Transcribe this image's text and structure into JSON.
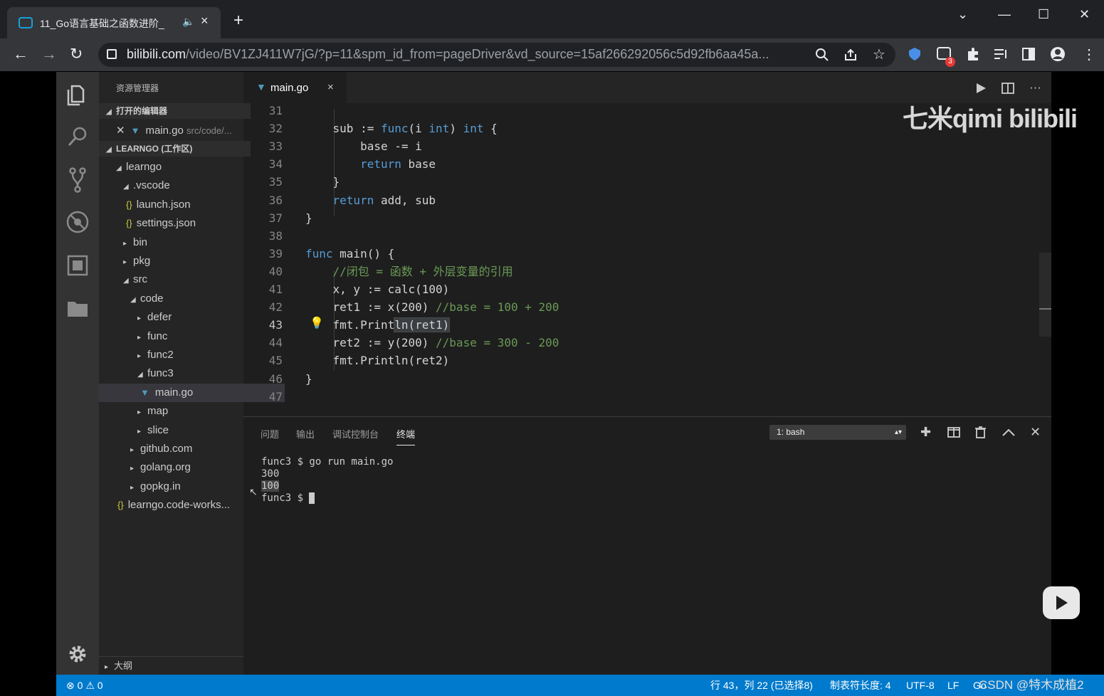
{
  "browser": {
    "tab_title": "11_Go语言基础之函数进阶_",
    "tab_speaker": "🔈",
    "tab_close": "×",
    "new_tab": "+",
    "window_controls": {
      "dropdown": "⌄",
      "minimize": "—",
      "maximize": "☐",
      "close": "✕"
    },
    "nav": {
      "back": "←",
      "forward": "→",
      "reload": "↻"
    },
    "url_host": "bilibili.com",
    "url_rest": "/video/BV1ZJ411W7jG/?p=11&spm_id_from=pageDriver&vd_source=15af266292056c5d92fb6aa45a...",
    "extension_badge": "3",
    "accent_color": "#18a0d8"
  },
  "vscode": {
    "sidebar": {
      "header": "资源管理器",
      "open_editors_label": "打开的编辑器",
      "open_editor_file": "main.go",
      "open_editor_path": "src/code/...",
      "workspace_label": "LEARNGO (工作区)",
      "tree": [
        {
          "label": "learngo",
          "arrow": "◢"
        },
        {
          "label": ".vscode",
          "arrow": "◢"
        },
        {
          "label": "launch.json",
          "icon": "{}"
        },
        {
          "label": "settings.json",
          "icon": "{}"
        },
        {
          "label": "bin",
          "arrow": "▸"
        },
        {
          "label": "pkg",
          "arrow": "▸"
        },
        {
          "label": "src",
          "arrow": "◢"
        },
        {
          "label": "code",
          "arrow": "◢"
        },
        {
          "label": "defer",
          "arrow": "▸"
        },
        {
          "label": "func",
          "arrow": "▸"
        },
        {
          "label": "func2",
          "arrow": "▸"
        },
        {
          "label": "func3",
          "arrow": "◢"
        },
        {
          "label": "main.go",
          "icon": "▼"
        },
        {
          "label": "map",
          "arrow": "▸"
        },
        {
          "label": "slice",
          "arrow": "▸"
        },
        {
          "label": "github.com",
          "arrow": "▸"
        },
        {
          "label": "golang.org",
          "arrow": "▸"
        },
        {
          "label": "gopkg.in",
          "arrow": "▸"
        },
        {
          "label": "learngo.code-works...",
          "icon": "{}"
        }
      ],
      "outline_label": "大纲"
    },
    "editor": {
      "tab_name": "main.go",
      "tab_close": "×",
      "watermark": "七米qimi bilibili",
      "current_line": 43,
      "lines": [
        {
          "n": "31",
          "code": ""
        },
        {
          "n": "32",
          "code": "    sub := <k>func</k>(i <k>int</k>) <k>int</k> {"
        },
        {
          "n": "33",
          "code": "        base -= i"
        },
        {
          "n": "34",
          "code": "        <k>return</k> base"
        },
        {
          "n": "35",
          "code": "    }"
        },
        {
          "n": "36",
          "code": "    <k>return</k> add, sub"
        },
        {
          "n": "37",
          "code": "}"
        },
        {
          "n": "38",
          "code": ""
        },
        {
          "n": "39",
          "code": "<k>func</k> main() {"
        },
        {
          "n": "40",
          "code": "    <c>//闭包 = 函数 + 外层变量的引用</c>"
        },
        {
          "n": "41",
          "code": "    x, y := calc(100)"
        },
        {
          "n": "42",
          "code": "    ret1 := x(200) <c>//base = 100 + 200</c>"
        },
        {
          "n": "43",
          "code": "    fmt.Print<h>ln(ret1)</h>"
        },
        {
          "n": "44",
          "code": "    ret2 := y(200) <c>//base = 300 - 200</c>"
        },
        {
          "n": "45",
          "code": "    fmt.Println(ret2)"
        },
        {
          "n": "46",
          "code": "}"
        },
        {
          "n": "47",
          "code": ""
        }
      ]
    },
    "panel": {
      "tabs": [
        "问题",
        "输出",
        "调试控制台",
        "终端"
      ],
      "active_tab": "终端",
      "terminal_select": "1: bash",
      "terminal_lines": [
        "func3 $ go run main.go",
        "300",
        "100",
        "func3 $ "
      ]
    },
    "statusbar": {
      "errors": "0",
      "warnings": "0",
      "position": "行 43，列 22 (已选择8)",
      "tab_size": "制表符长度: 4",
      "encoding": "UTF-8",
      "eol": "LF",
      "language": "Go",
      "csdn_watermark": "CSDN @特木成植2",
      "color": "#007acc"
    }
  }
}
